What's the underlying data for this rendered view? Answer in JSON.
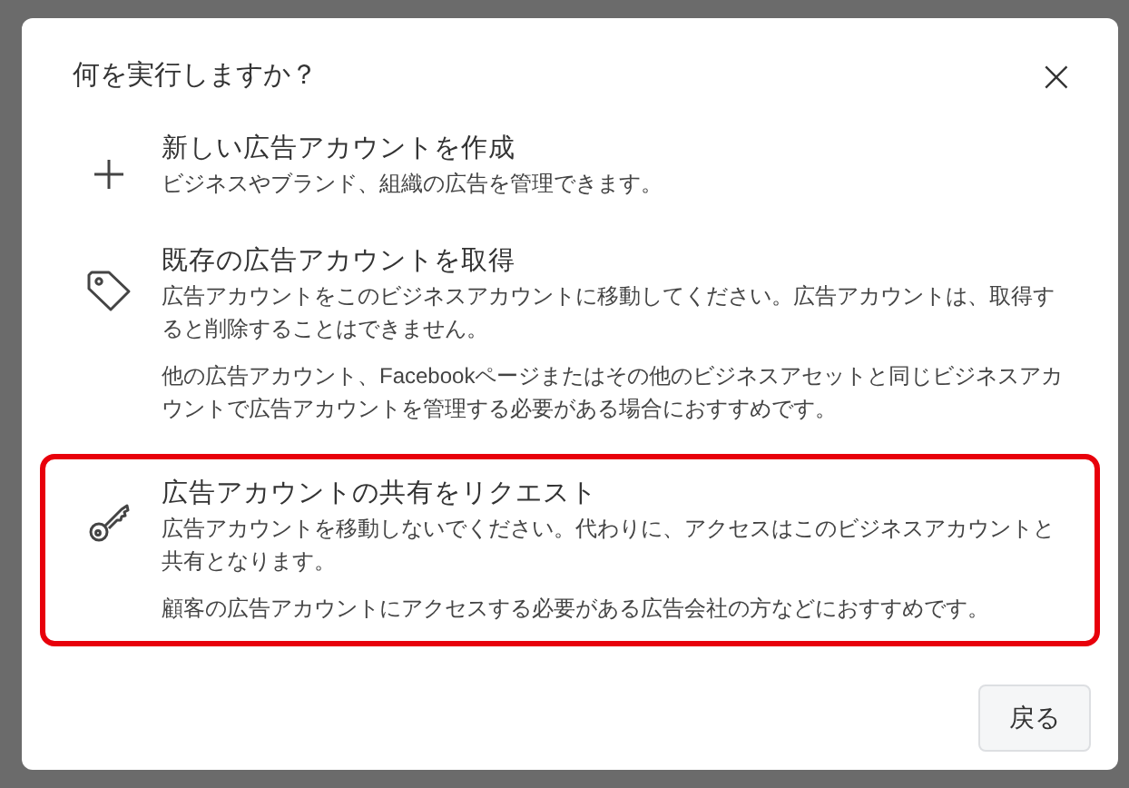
{
  "dialog": {
    "title": "何を実行しますか？",
    "close": "×"
  },
  "options": [
    {
      "title": "新しい広告アカウントを作成",
      "paragraphs": [
        "ビジネスやブランド、組織の広告を管理できます。"
      ],
      "highlighted": false
    },
    {
      "title": "既存の広告アカウントを取得",
      "paragraphs": [
        "広告アカウントをこのビジネスアカウントに移動してください。広告アカウントは、取得すると削除することはできません。",
        "他の広告アカウント、Facebookページまたはその他のビジネスアセットと同じビジネスアカウントで広告アカウントを管理する必要がある場合におすすめです。"
      ],
      "highlighted": false
    },
    {
      "title": "広告アカウントの共有をリクエスト",
      "paragraphs": [
        "広告アカウントを移動しないでください。代わりに、アクセスはこのビジネスアカウントと共有となります。",
        "顧客の広告アカウントにアクセスする必要がある広告会社の方などにおすすめです。"
      ],
      "highlighted": true
    }
  ],
  "buttons": [
    {
      "label": "戻る"
    }
  ]
}
